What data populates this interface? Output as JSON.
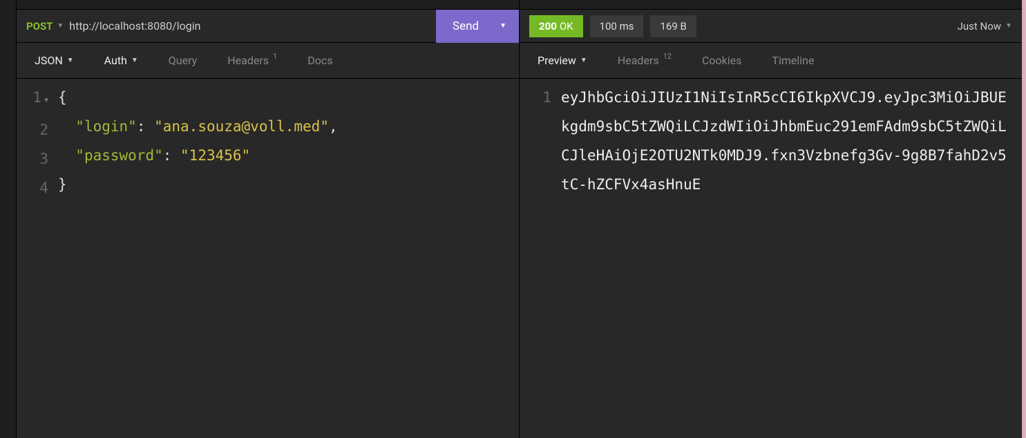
{
  "request": {
    "method": "POST",
    "url": "http://localhost:8080/login",
    "send_label": "Send",
    "tabs": {
      "body": "JSON",
      "auth": "Auth",
      "query": "Query",
      "headers": "Headers",
      "headers_badge": "1",
      "docs": "Docs"
    },
    "body_lines": {
      "l1": "1",
      "l2": "2",
      "l3": "3",
      "l4": "4"
    },
    "body_json": {
      "open": "{",
      "key1": "\"login\"",
      "colon1": ": ",
      "val1": "\"ana.souza@voll.med\"",
      "comma1": ",",
      "key2": "\"password\"",
      "colon2": ": ",
      "val2": "\"123456\"",
      "close": "}"
    }
  },
  "response": {
    "status_code": "200",
    "status_text": "OK",
    "time": "100 ms",
    "size": "169 B",
    "timestamp": "Just Now",
    "tabs": {
      "preview": "Preview",
      "headers": "Headers",
      "headers_badge": "12",
      "cookies": "Cookies",
      "timeline": "Timeline"
    },
    "body_line_number": "1",
    "body": "eyJhbGciOiJIUzI1NiIsInR5cCI6IkpXVCJ9.eyJpc3MiOiJBUEkgdm9sbC5tZWQiLCJzdWIiOiJhbmEuc291emFAdm9sbC5tZWQiLCJleHAiOjE2OTU2NTk0MDJ9.fxn3Vzbnefg3Gv-9g8B7fahD2v5tC-hZCFVx4asHnuE"
  }
}
